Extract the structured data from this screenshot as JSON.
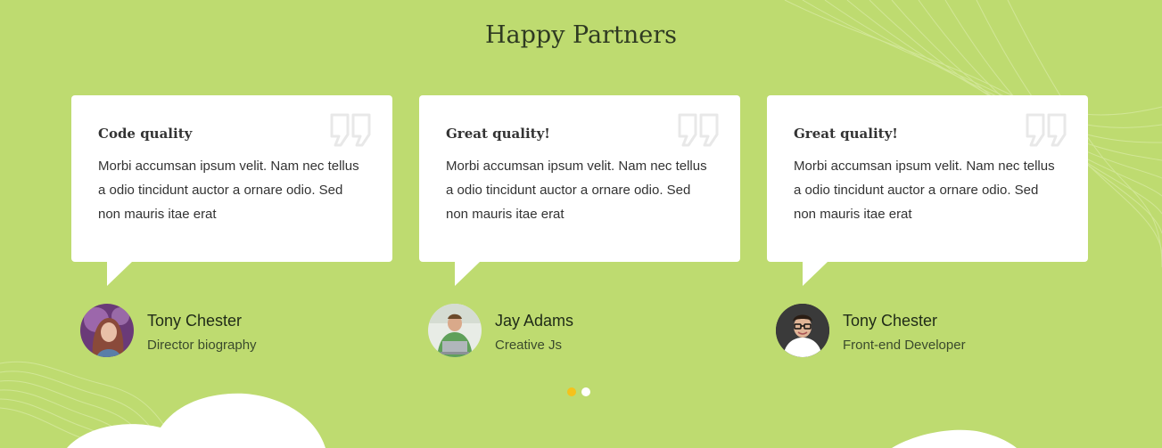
{
  "section": {
    "title": "Happy Partners"
  },
  "testimonials": [
    {
      "title": "Code quality",
      "text": "Morbi accumsan ipsum velit. Nam nec tellus a odio tincidunt auctor a ornare odio. Sed non mauris itae erat",
      "name": "Tony Chester",
      "role": "Director biography",
      "avatar_icon": "woman-portrait-avatar"
    },
    {
      "title": "Great quality!",
      "text": "Morbi accumsan ipsum velit. Nam nec tellus a odio tincidunt auctor a ornare odio. Sed non mauris itae erat",
      "name": "Jay Adams",
      "role": "Creative Js",
      "avatar_icon": "man-laptop-avatar"
    },
    {
      "title": "Great quality!",
      "text": "Morbi accumsan ipsum velit. Nam nec tellus a odio tincidunt auctor a ornare odio. Sed non mauris itae erat",
      "name": "Tony Chester",
      "role": "Front-end Developer",
      "avatar_icon": "man-glasses-avatar"
    }
  ],
  "carousel": {
    "pages": 2,
    "active_page": 1
  },
  "colors": {
    "background": "#bedb70",
    "card": "#ffffff",
    "dot_active": "#f5c21b",
    "dot_inactive": "#ffffff"
  }
}
